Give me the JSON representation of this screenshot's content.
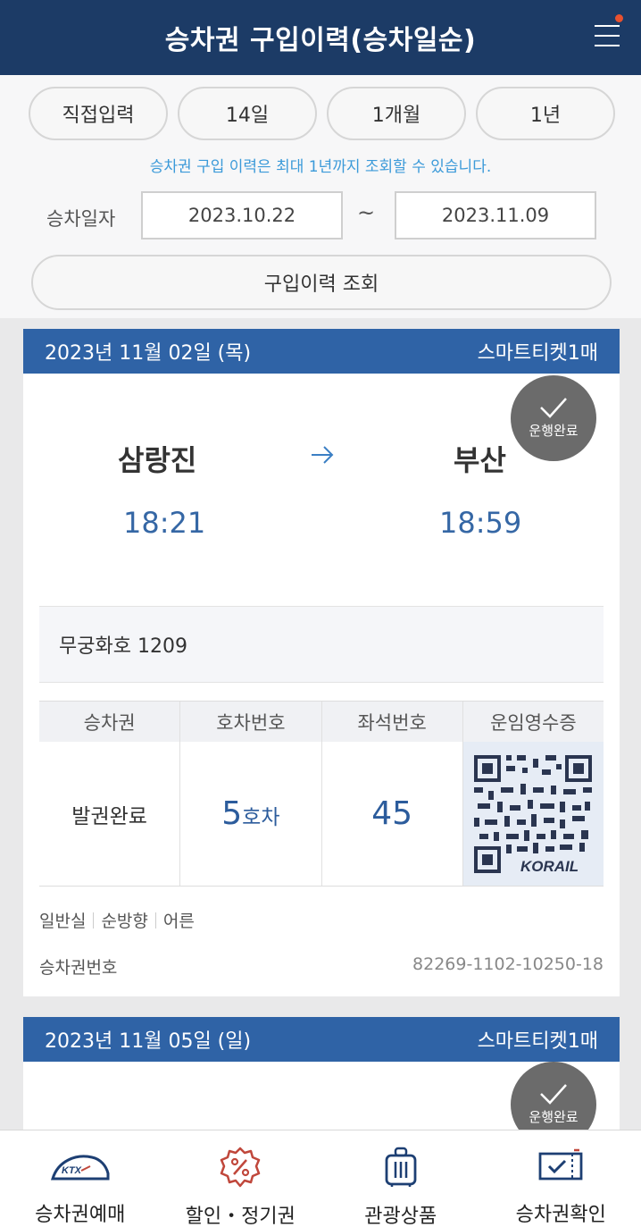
{
  "header": {
    "title": "승차권 구입이력(승차일순)",
    "menu_icon": "hamburger-menu-icon",
    "badge_color": "#e8512f"
  },
  "filter": {
    "ranges": [
      "직접입력",
      "14일",
      "1개월",
      "1년"
    ],
    "notice": "승차권 구입 이력은 최대 1년까지 조회할 수 있습니다.",
    "date_label": "승차일자",
    "start_date": "2023.10.22",
    "separator": "~",
    "end_date": "2023.11.09",
    "search_label": "구입이력 조회"
  },
  "tickets": [
    {
      "date": "2023년 11월 02일 (목)",
      "ticket_kind": "스마트티켓1매",
      "status_badge": "운행완료",
      "from_station": "삼랑진",
      "to_station": "부산",
      "depart_time": "18:21",
      "arrive_time": "18:59",
      "train": "무궁화호 1209",
      "columns": [
        "승차권",
        "호차번호",
        "좌석번호",
        "운임영수증"
      ],
      "issue_status": "발권완료",
      "car_number": "5",
      "car_unit": "호차",
      "seat_number": "45",
      "receipt_brand": "KORAIL",
      "class": "일반실",
      "direction": "순방향",
      "passenger": "어른",
      "ticket_no_label": "승차권번호",
      "ticket_no": "82269-1102-10250-18"
    },
    {
      "date": "2023년 11월 05일 (일)",
      "ticket_kind": "스마트티켓1매",
      "status_badge": "운행완료"
    }
  ],
  "bottom_nav": [
    {
      "label": "승차권예매",
      "icon": "ktx-train-icon"
    },
    {
      "label": "할인・정기권",
      "icon": "discount-badge-icon"
    },
    {
      "label": "관광상품",
      "icon": "luggage-icon"
    },
    {
      "label": "승차권확인",
      "icon": "ticket-check-icon"
    }
  ],
  "colors": {
    "header_bg": "#1c3b66",
    "card_head_bg": "#2f63a6",
    "accent_blue": "#3567a5",
    "notice_blue": "#3b9ad9",
    "icon_red": "#c0473b"
  }
}
